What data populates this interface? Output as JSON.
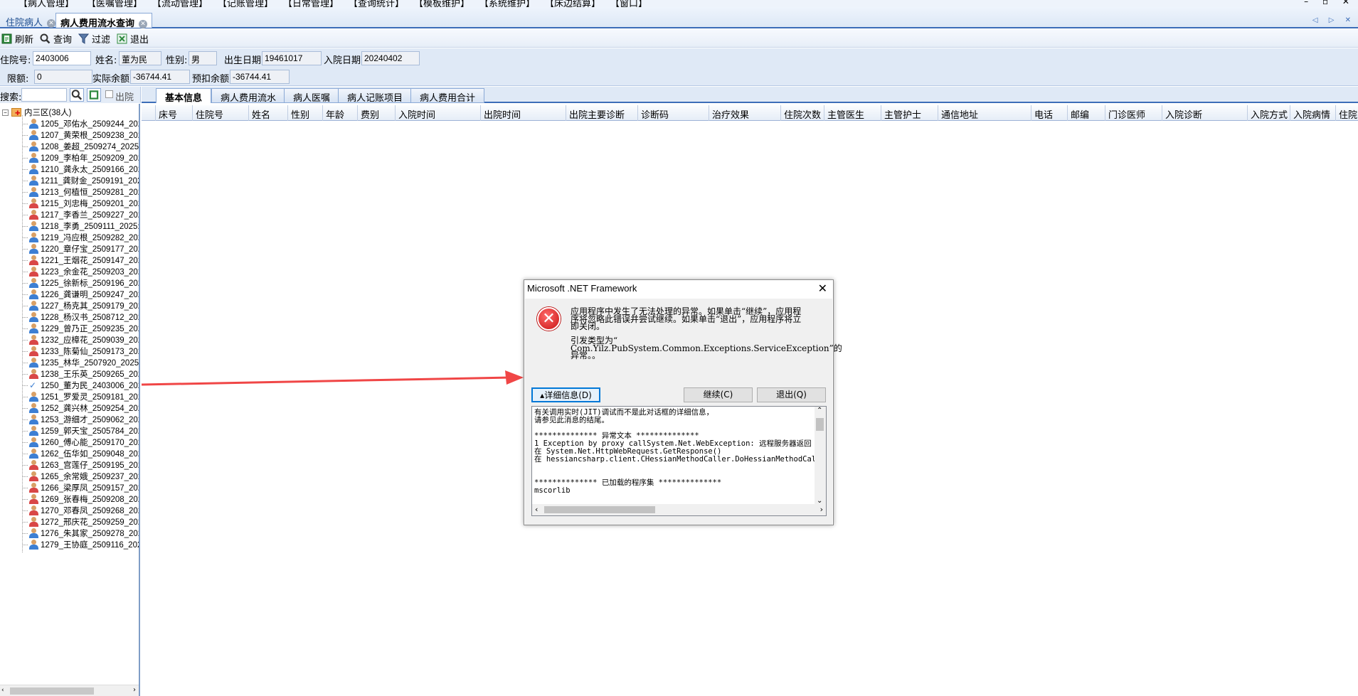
{
  "menubar": {
    "items": [
      "【病人管理】",
      "【医嘱管理】",
      "【流动管理】",
      "【记账管理】",
      "【日常管理】",
      "【查询统计】",
      "【模板维护】",
      "【系统维护】",
      "【床边结算】",
      "【窗口】"
    ],
    "window_controls": "– ▫ ✕"
  },
  "doc_tabs": [
    {
      "label": "住院病人"
    },
    {
      "label": "病人费用流水查询"
    }
  ],
  "tab_nav": "◁ ▷ ✕",
  "toolbar": {
    "refresh": "刷新",
    "query": "查询",
    "filter": "过滤",
    "exit": "退出"
  },
  "patient": {
    "admission_no_label": "住院号:",
    "admission_no": "2403006",
    "name_label": "姓名:",
    "name": "董为民",
    "sex_label": "性别:",
    "sex": "男",
    "birth_label": "出生日期:",
    "birth": "19461017",
    "admit_date_label": "入院日期:",
    "admit_date": "20240402",
    "limit_label": "限额:",
    "limit": "0",
    "actual_balance_label": "实际余额:",
    "actual_balance": "-36744.41",
    "withhold_balance_label": "预扣余额:",
    "withhold_balance": "-36744.41"
  },
  "search": {
    "label": "搜索:",
    "placeholder": "",
    "out_checkbox": "出院"
  },
  "inner_tabs": [
    "基本信息",
    "病人费用流水",
    "病人医嘱",
    "病人记账项目",
    "病人费用合计"
  ],
  "tree": {
    "root": "内三区(38人)",
    "items": [
      {
        "label": "1205_邓佑水_2509244_202",
        "sex": "m"
      },
      {
        "label": "1207_黄荣根_2509238_202",
        "sex": "m"
      },
      {
        "label": "1208_姜超_2509274_2025:",
        "sex": "m"
      },
      {
        "label": "1209_李柏年_2509209_202",
        "sex": "m"
      },
      {
        "label": "1210_龚永太_2509166_202",
        "sex": "m"
      },
      {
        "label": "1211_龚财金_2509191_202",
        "sex": "m"
      },
      {
        "label": "1213_何植恒_2509281_202",
        "sex": "m"
      },
      {
        "label": "1215_刘忠梅_2509201_202",
        "sex": "f"
      },
      {
        "label": "1217_李香兰_2509227_202",
        "sex": "f"
      },
      {
        "label": "1218_李勇_2509111_2025:",
        "sex": "m"
      },
      {
        "label": "1219_冯应根_2509282_202",
        "sex": "m"
      },
      {
        "label": "1220_章仔宝_2509177_202",
        "sex": "m"
      },
      {
        "label": "1221_王烟花_2509147_202",
        "sex": "f"
      },
      {
        "label": "1223_余金花_2509203_202",
        "sex": "f"
      },
      {
        "label": "1225_徐新标_2509196_202",
        "sex": "m"
      },
      {
        "label": "1226_龚谦明_2509247_202",
        "sex": "m"
      },
      {
        "label": "1227_杨克其_2509179_202",
        "sex": "m"
      },
      {
        "label": "1228_杨汉书_2508712_202",
        "sex": "m"
      },
      {
        "label": "1229_曾乃正_2509235_202",
        "sex": "m"
      },
      {
        "label": "1232_应樟花_2509039_202",
        "sex": "f"
      },
      {
        "label": "1233_陈菊仙_2509173_202",
        "sex": "f"
      },
      {
        "label": "1235_林华_2507920_20250",
        "sex": "m"
      },
      {
        "label": "1238_王乐英_2509265_202",
        "sex": "f"
      },
      {
        "label": "1250_董为民_2403006_202",
        "sex": "sel"
      },
      {
        "label": "1251_罗爱灵_2509181_202",
        "sex": "m"
      },
      {
        "label": "1252_龚兴林_2509254_202",
        "sex": "m"
      },
      {
        "label": "1253_游细才_2509062_202",
        "sex": "m"
      },
      {
        "label": "1259_郭天宝_2505784_202",
        "sex": "m"
      },
      {
        "label": "1260_傅心能_2509170_202",
        "sex": "m"
      },
      {
        "label": "1262_伍华如_2509048_202",
        "sex": "m"
      },
      {
        "label": "1263_宫莲仔_2509195_202",
        "sex": "f"
      },
      {
        "label": "1265_余常娥_2509237_202",
        "sex": "f"
      },
      {
        "label": "1266_梁厚凤_2509157_202",
        "sex": "f"
      },
      {
        "label": "1269_张春梅_2509208_202",
        "sex": "f"
      },
      {
        "label": "1270_邓春凤_2509268_202",
        "sex": "f"
      },
      {
        "label": "1272_邢庆花_2509259_202",
        "sex": "f"
      },
      {
        "label": "1276_朱其家_2509278_202",
        "sex": "m"
      },
      {
        "label": "1279_王协庭_2509116_202",
        "sex": "m"
      }
    ]
  },
  "grid": {
    "columns": [
      "床号",
      "住院号",
      "姓名",
      "性别",
      "年龄",
      "费别",
      "入院时间",
      "出院时间",
      "出院主要诊断",
      "诊断码",
      "治疗效果",
      "住院次数",
      "主管医生",
      "主管护士",
      "通信地址",
      "电话",
      "邮编",
      "门诊医师",
      "入院诊断",
      "入院方式",
      "入院病情",
      "住院日"
    ]
  },
  "dialog": {
    "title": "Microsoft .NET Framework",
    "message_lines": [
      "应用程序中发生了无法处理的异常。如果单击“继续”，应用程",
      "序将忽略此错误并尝试继续。如果单击“退出”，应用程序将立",
      "即关闭。",
      "",
      "引发类型为“",
      "Com.Yilz.PubSystem.Common.Exceptions.ServiceException”的",
      "异常。。"
    ],
    "details_button": "▴详细信息(D)",
    "continue_button": "继续(C)",
    "quit_button": "退出(Q)",
    "detail_lines": [
      "有关调用实时(JIT)调试而不是此对话框的详细信息，",
      "请参见此消息的结尾。",
      "",
      "************** 异常文本 **************",
      "1   Exception by proxy callSystem.Net.WebException: 远程服务器返回",
      "   在 System.Net.HttpWebRequest.GetResponse()",
      "   在 hessiancsharp.client.CHessianMethodCaller.DoHessianMethodCal",
      "",
      "",
      "************** 已加载的程序集 **************",
      "mscorlib"
    ]
  },
  "colors": {
    "accent": "#3c6db8",
    "arrow": "#f04646",
    "error": "#c81212"
  }
}
